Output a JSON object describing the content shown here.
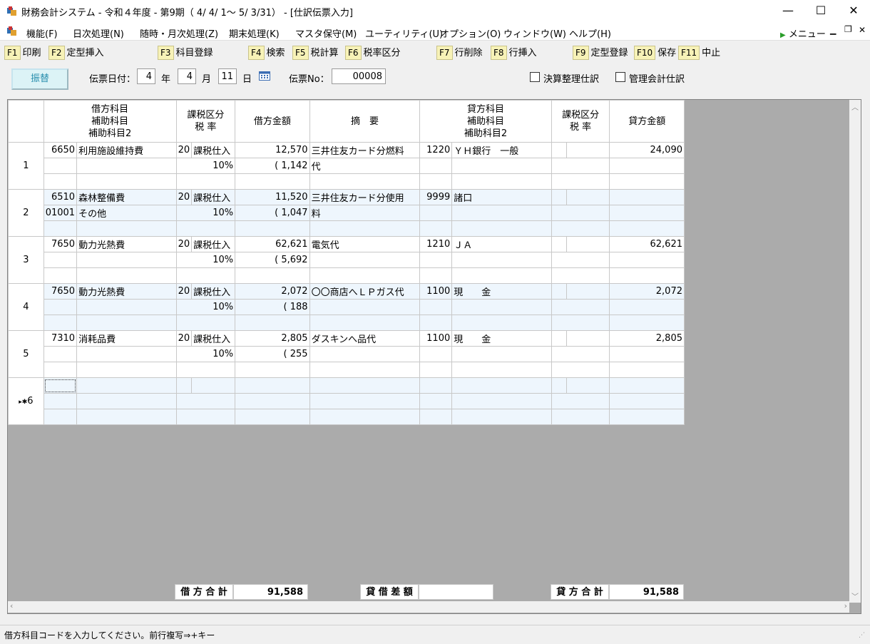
{
  "window": {
    "title": "財務会計システム - 令和４年度 - 第9期（ 4/ 4/ 1～ 5/ 3/31） - [仕訳伝票入力]"
  },
  "menu": {
    "items": [
      "機能(F)",
      "日次処理(N)",
      "随時・月次処理(Z)",
      "期末処理(K)",
      "マスタ保守(M)",
      "ユーティリティ(U)",
      "オプション(O)",
      "ウィンドウ(W)",
      "ヘルプ(H)"
    ],
    "right_menu": "メニュー"
  },
  "fkeys": [
    {
      "key": "F1",
      "label": "印刷"
    },
    {
      "key": "F2",
      "label": "定型挿入"
    },
    {
      "key": "F3",
      "label": "科目登録"
    },
    {
      "key": "F4",
      "label": "検索"
    },
    {
      "key": "F5",
      "label": "税計算"
    },
    {
      "key": "F6",
      "label": "税率区分"
    },
    {
      "key": "F7",
      "label": "行削除"
    },
    {
      "key": "F8",
      "label": "行挿入"
    },
    {
      "key": "F9",
      "label": "定型登録"
    },
    {
      "key": "F10",
      "label": "保存"
    },
    {
      "key": "F11",
      "label": "中止"
    }
  ],
  "header": {
    "type_button": "振替",
    "date_label": "伝票日付：",
    "year": "4",
    "year_unit": "年",
    "month": "4",
    "month_unit": "月",
    "day": "11",
    "day_unit": "日",
    "no_label": "伝票No：",
    "no": "00008",
    "chk_closing": "決算整理仕訳",
    "chk_mgmt": "管理会計仕訳"
  },
  "columns": {
    "debit_account": [
      "借方科目",
      "補助科目",
      "補助科目2"
    ],
    "debit_tax": [
      "課税区分",
      "税 率"
    ],
    "debit_amount": "借方金額",
    "summary": "摘　要",
    "credit_account": [
      "貸方科目",
      "補助科目",
      "補助科目2"
    ],
    "credit_tax": [
      "課税区分",
      "税 率"
    ],
    "credit_amount": "貸方金額"
  },
  "rows": [
    {
      "no": "1",
      "d_code": "6650",
      "d_name": "利用施設維持費",
      "d_sub_code": "",
      "d_sub_name": "",
      "d_tax_code": "20",
      "d_tax_name": "課税仕入",
      "d_rate": "10%",
      "d_amount": "12,570",
      "d_tax": "( 1,142",
      "summary1": "三井住友カード分燃料",
      "summary2": "代",
      "c_code": "1220",
      "c_name": "ＹＨ銀行　一般",
      "c_amount": "24,090"
    },
    {
      "no": "2",
      "d_code": "6510",
      "d_name": "森林整備費",
      "d_sub_code": "01001",
      "d_sub_name": "その他",
      "d_tax_code": "20",
      "d_tax_name": "課税仕入",
      "d_rate": "10%",
      "d_amount": "11,520",
      "d_tax": "( 1,047",
      "summary1": "三井住友カード分使用",
      "summary2": "料",
      "c_code": "9999",
      "c_name": "諸口",
      "c_amount": ""
    },
    {
      "no": "3",
      "d_code": "7650",
      "d_name": "動力光熱費",
      "d_sub_code": "",
      "d_sub_name": "",
      "d_tax_code": "20",
      "d_tax_name": "課税仕入",
      "d_rate": "10%",
      "d_amount": "62,621",
      "d_tax": "( 5,692",
      "summary1": "電気代",
      "summary2": "",
      "c_code": "1210",
      "c_name": "ＪＡ",
      "c_amount": "62,621"
    },
    {
      "no": "4",
      "d_code": "7650",
      "d_name": "動力光熱費",
      "d_sub_code": "",
      "d_sub_name": "",
      "d_tax_code": "20",
      "d_tax_name": "課税仕入",
      "d_rate": "10%",
      "d_amount": "2,072",
      "d_tax": "( 188",
      "summary1": "〇〇商店へＬＰガス代",
      "summary2": "",
      "c_code": "1100",
      "c_name": "現　　金",
      "c_amount": "2,072"
    },
    {
      "no": "5",
      "d_code": "7310",
      "d_name": "消耗品費",
      "d_sub_code": "",
      "d_sub_name": "",
      "d_tax_code": "20",
      "d_tax_name": "課税仕入",
      "d_rate": "10%",
      "d_amount": "2,805",
      "d_tax": "( 255",
      "summary1": "ダスキンへ品代",
      "summary2": "",
      "c_code": "1100",
      "c_name": "現　　金",
      "c_amount": "2,805"
    },
    {
      "no": "6",
      "d_code": "",
      "d_name": "",
      "d_sub_code": "",
      "d_sub_name": "",
      "d_tax_code": "",
      "d_tax_name": "",
      "d_rate": "",
      "d_amount": "",
      "d_tax": "",
      "summary1": "",
      "summary2": "",
      "c_code": "",
      "c_name": "",
      "c_amount": ""
    }
  ],
  "current_row_marker": "▸✱",
  "totals": {
    "debit_label": "借 方 合 計",
    "debit_value": "91,588",
    "diff_label": "貸 借 差 額",
    "diff_value": "",
    "credit_label": "貸 方 合 計",
    "credit_value": "91,588"
  },
  "status": {
    "text": "借方科目コードを入力してください。前行複写⇒+キー"
  }
}
